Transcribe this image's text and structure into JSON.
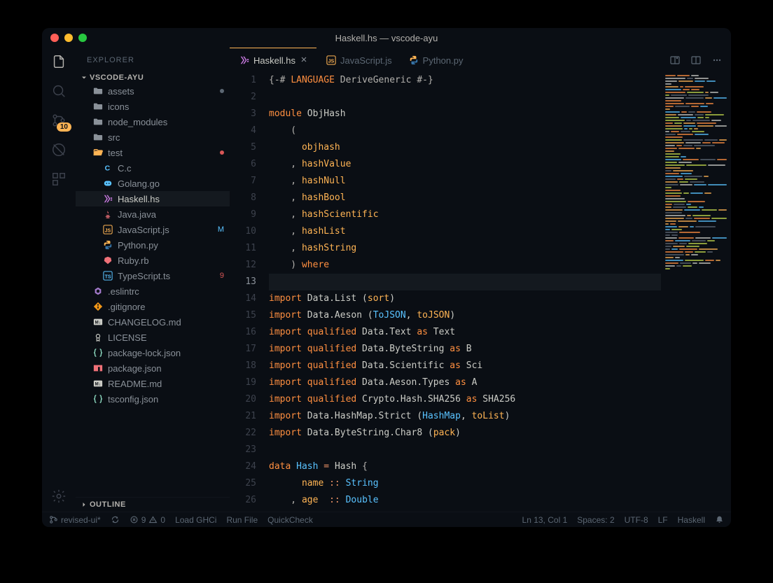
{
  "window": {
    "title": "Haskell.hs — vscode-ayu"
  },
  "activitybar": {
    "badge": "10"
  },
  "sidebar": {
    "title": "EXPLORER",
    "section": "VSCODE-AYU",
    "outline": "OUTLINE"
  },
  "tree": [
    {
      "depth": 1,
      "icon": "folder",
      "label": "assets",
      "color": "#8a9199",
      "decor": "dot"
    },
    {
      "depth": 1,
      "icon": "folder",
      "label": "icons",
      "color": "#8a9199"
    },
    {
      "depth": 1,
      "icon": "folder",
      "label": "node_modules",
      "color": "#8a9199"
    },
    {
      "depth": 1,
      "icon": "folder",
      "label": "src",
      "color": "#8a9199"
    },
    {
      "depth": 1,
      "icon": "folder-open",
      "label": "test",
      "color": "#ffb454",
      "decor": "reddot"
    },
    {
      "depth": 2,
      "icon": "c",
      "label": "C.c",
      "color": "#59c2ff"
    },
    {
      "depth": 2,
      "icon": "go",
      "label": "Golang.go",
      "color": "#59c2ff"
    },
    {
      "depth": 2,
      "icon": "haskell",
      "label": "Haskell.hs",
      "color": "#c678dd",
      "active": true
    },
    {
      "depth": 2,
      "icon": "java",
      "label": "Java.java",
      "color": "#f07178"
    },
    {
      "depth": 2,
      "icon": "js",
      "label": "JavaScript.js",
      "color": "#ffb454",
      "decor": "M",
      "decorColor": "#59c2ff"
    },
    {
      "depth": 2,
      "icon": "python",
      "label": "Python.py",
      "color": "#ffb454"
    },
    {
      "depth": 2,
      "icon": "ruby",
      "label": "Ruby.rb",
      "color": "#f07178"
    },
    {
      "depth": 2,
      "icon": "ts",
      "label": "TypeScript.ts",
      "color": "#59c2ff",
      "decor": "9",
      "decorColor": "#d95757"
    },
    {
      "depth": 1,
      "icon": "eslint",
      "label": ".eslintrc",
      "color": "#a37acc"
    },
    {
      "depth": 1,
      "icon": "git",
      "label": ".gitignore",
      "color": "#f29718"
    },
    {
      "depth": 1,
      "icon": "md",
      "label": "CHANGELOG.md",
      "color": "#cbccc6"
    },
    {
      "depth": 1,
      "icon": "license",
      "label": "LICENSE",
      "color": "#cbccc6"
    },
    {
      "depth": 1,
      "icon": "json",
      "label": "package-lock.json",
      "color": "#95e6cb"
    },
    {
      "depth": 1,
      "icon": "npm",
      "label": "package.json",
      "color": "#f07178"
    },
    {
      "depth": 1,
      "icon": "md",
      "label": "README.md",
      "color": "#cbccc6"
    },
    {
      "depth": 1,
      "icon": "json",
      "label": "tsconfig.json",
      "color": "#95e6cb"
    }
  ],
  "tabs": [
    {
      "icon": "haskell",
      "label": "Haskell.hs",
      "active": true,
      "iconColor": "#c678dd"
    },
    {
      "icon": "js",
      "label": "JavaScript.js",
      "iconColor": "#ffb454"
    },
    {
      "icon": "python",
      "label": "Python.py",
      "iconColor": "#ffb454"
    }
  ],
  "code": [
    [
      {
        "t": "{-# ",
        "c": "punc"
      },
      {
        "t": "LANGUAGE",
        "c": "kw"
      },
      {
        "t": " DeriveGeneric #-}",
        "c": "punc"
      }
    ],
    [],
    [
      {
        "t": "module",
        "c": "kw"
      },
      {
        "t": " ObjHash",
        "c": "text"
      }
    ],
    [
      {
        "t": "    (",
        "c": "punc"
      }
    ],
    [
      {
        "t": "      ",
        "c": "punc"
      },
      {
        "t": "objhash",
        "c": "fn"
      }
    ],
    [
      {
        "t": "    , ",
        "c": "punc"
      },
      {
        "t": "hashValue",
        "c": "fn"
      }
    ],
    [
      {
        "t": "    , ",
        "c": "punc"
      },
      {
        "t": "hashNull",
        "c": "fn"
      }
    ],
    [
      {
        "t": "    , ",
        "c": "punc"
      },
      {
        "t": "hashBool",
        "c": "fn"
      }
    ],
    [
      {
        "t": "    , ",
        "c": "punc"
      },
      {
        "t": "hashScientific",
        "c": "fn"
      }
    ],
    [
      {
        "t": "    , ",
        "c": "punc"
      },
      {
        "t": "hashList",
        "c": "fn"
      }
    ],
    [
      {
        "t": "    , ",
        "c": "punc"
      },
      {
        "t": "hashString",
        "c": "fn"
      }
    ],
    [
      {
        "t": "    ) ",
        "c": "punc"
      },
      {
        "t": "where",
        "c": "kw"
      }
    ],
    [],
    [
      {
        "t": "import",
        "c": "kw"
      },
      {
        "t": " Data.List (",
        "c": "text"
      },
      {
        "t": "sort",
        "c": "fn"
      },
      {
        "t": ")",
        "c": "text"
      }
    ],
    [
      {
        "t": "import",
        "c": "kw"
      },
      {
        "t": " Data.Aeson (",
        "c": "text"
      },
      {
        "t": "ToJSON",
        "c": "type"
      },
      {
        "t": ", ",
        "c": "text"
      },
      {
        "t": "toJSON",
        "c": "fn"
      },
      {
        "t": ")",
        "c": "text"
      }
    ],
    [
      {
        "t": "import qualified",
        "c": "kw"
      },
      {
        "t": " Data.Text ",
        "c": "text"
      },
      {
        "t": "as",
        "c": "kw"
      },
      {
        "t": " Text",
        "c": "text"
      }
    ],
    [
      {
        "t": "import qualified",
        "c": "kw"
      },
      {
        "t": " Data.ByteString ",
        "c": "text"
      },
      {
        "t": "as",
        "c": "kw"
      },
      {
        "t": " B",
        "c": "text"
      }
    ],
    [
      {
        "t": "import qualified",
        "c": "kw"
      },
      {
        "t": " Data.Scientific ",
        "c": "text"
      },
      {
        "t": "as",
        "c": "kw"
      },
      {
        "t": " Sci",
        "c": "text"
      }
    ],
    [
      {
        "t": "import qualified",
        "c": "kw"
      },
      {
        "t": " Data.Aeson.Types ",
        "c": "text"
      },
      {
        "t": "as",
        "c": "kw"
      },
      {
        "t": " A",
        "c": "text"
      }
    ],
    [
      {
        "t": "import qualified",
        "c": "kw"
      },
      {
        "t": " Crypto.Hash.SHA256 ",
        "c": "text"
      },
      {
        "t": "as",
        "c": "kw"
      },
      {
        "t": " SHA256",
        "c": "text"
      }
    ],
    [
      {
        "t": "import",
        "c": "kw"
      },
      {
        "t": " Data.HashMap.Strict (",
        "c": "text"
      },
      {
        "t": "HashMap",
        "c": "type"
      },
      {
        "t": ", ",
        "c": "text"
      },
      {
        "t": "toList",
        "c": "fn"
      },
      {
        "t": ")",
        "c": "text"
      }
    ],
    [
      {
        "t": "import",
        "c": "kw"
      },
      {
        "t": " Data.ByteString.Char8 (",
        "c": "text"
      },
      {
        "t": "pack",
        "c": "fn"
      },
      {
        "t": ")",
        "c": "text"
      }
    ],
    [],
    [
      {
        "t": "data",
        "c": "kw"
      },
      {
        "t": " ",
        "c": "text"
      },
      {
        "t": "Hash",
        "c": "type"
      },
      {
        "t": " = ",
        "c": "op"
      },
      {
        "t": "Hash",
        "c": "text"
      },
      {
        "t": " {",
        "c": "punc"
      }
    ],
    [
      {
        "t": "      ",
        "c": "punc"
      },
      {
        "t": "name",
        "c": "fn"
      },
      {
        "t": " :: ",
        "c": "op"
      },
      {
        "t": "String",
        "c": "type"
      }
    ],
    [
      {
        "t": "    , ",
        "c": "punc"
      },
      {
        "t": "age",
        "c": "fn"
      },
      {
        "t": "  :: ",
        "c": "op"
      },
      {
        "t": "Double",
        "c": "type"
      }
    ]
  ],
  "currentLine": 13,
  "statusbar": {
    "branch": "revised-ui*",
    "errors": "9",
    "warnings": "0",
    "action1": "Load GHCi",
    "action2": "Run File",
    "action3": "QuickCheck",
    "pos": "Ln 13, Col 1",
    "spaces": "Spaces: 2",
    "encoding": "UTF-8",
    "eol": "LF",
    "lang": "Haskell"
  }
}
